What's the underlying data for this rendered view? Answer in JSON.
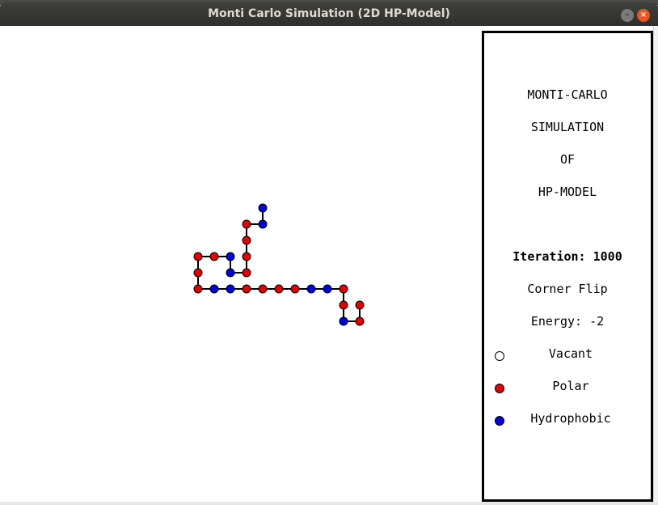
{
  "window": {
    "title": "Monti Carlo Simulation (2D HP-Model)",
    "minimize_glyph": "–",
    "close_glyph": "×"
  },
  "panel": {
    "heading": [
      "MONTI-CARLO",
      "SIMULATION",
      "OF",
      "HP-MODEL"
    ],
    "iteration": "Iteration: 1000",
    "move": "Corner Flip",
    "energy": "Energy: -2",
    "legend": [
      {
        "label": "Vacant",
        "color": "#ffffff"
      },
      {
        "label": "Polar",
        "color": "#e60000"
      },
      {
        "label": "Hydrophobic",
        "color": "#0000e6"
      }
    ]
  },
  "chain": {
    "colors": {
      "P": "#e60000",
      "H": "#0000e6"
    },
    "residues": [
      {
        "x": 10,
        "y": 0,
        "type": "H"
      },
      {
        "x": 10,
        "y": 1,
        "type": "H"
      },
      {
        "x": 9,
        "y": 1,
        "type": "P"
      },
      {
        "x": 9,
        "y": 2,
        "type": "P"
      },
      {
        "x": 9,
        "y": 3,
        "type": "P"
      },
      {
        "x": 9,
        "y": 4,
        "type": "P"
      },
      {
        "x": 8,
        "y": 4,
        "type": "H"
      },
      {
        "x": 8,
        "y": 3,
        "type": "H"
      },
      {
        "x": 7,
        "y": 3,
        "type": "P"
      },
      {
        "x": 6,
        "y": 3,
        "type": "P"
      },
      {
        "x": 6,
        "y": 4,
        "type": "P"
      },
      {
        "x": 6,
        "y": 5,
        "type": "P"
      },
      {
        "x": 7,
        "y": 5,
        "type": "H"
      },
      {
        "x": 8,
        "y": 5,
        "type": "H"
      },
      {
        "x": 9,
        "y": 5,
        "type": "P"
      },
      {
        "x": 10,
        "y": 5,
        "type": "P"
      },
      {
        "x": 11,
        "y": 5,
        "type": "P"
      },
      {
        "x": 12,
        "y": 5,
        "type": "P"
      },
      {
        "x": 13,
        "y": 5,
        "type": "H"
      },
      {
        "x": 14,
        "y": 5,
        "type": "H"
      },
      {
        "x": 15,
        "y": 5,
        "type": "P"
      },
      {
        "x": 15,
        "y": 6,
        "type": "P"
      },
      {
        "x": 15,
        "y": 7,
        "type": "H"
      },
      {
        "x": 16,
        "y": 7,
        "type": "P"
      },
      {
        "x": 16,
        "y": 6,
        "type": "P"
      }
    ]
  }
}
